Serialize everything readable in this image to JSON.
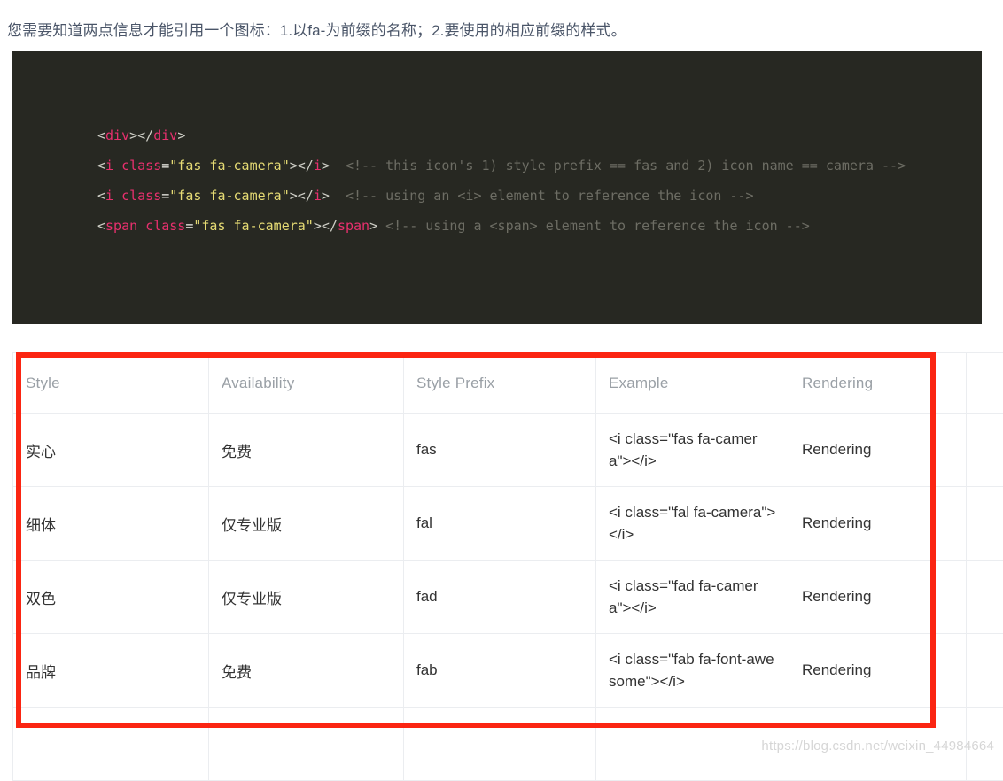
{
  "page": {
    "intro": "您需要知道两点信息才能引用一个图标：1.以fa-为前缀的名称；2.要使用的相应前缀的样式。",
    "watermark": "https://blog.csdn.net/weixin_44984664"
  },
  "code_block": {
    "background_color": "#272822",
    "lines": [
      {
        "id": "line-1",
        "tokens": [
          {
            "type": "punct",
            "text": "<"
          },
          {
            "type": "tag",
            "text": "div"
          },
          {
            "type": "punct",
            "text": "></"
          },
          {
            "type": "tag",
            "text": "div"
          },
          {
            "type": "punct",
            "text": ">"
          }
        ]
      },
      {
        "id": "line-2",
        "tokens": [
          {
            "type": "punct",
            "text": "<"
          },
          {
            "type": "tag",
            "text": "i"
          },
          {
            "type": "punct",
            "text": " "
          },
          {
            "type": "attr",
            "text": "class"
          },
          {
            "type": "op",
            "text": "="
          },
          {
            "type": "string",
            "text": "\"fas fa-camera\""
          },
          {
            "type": "punct",
            "text": "></"
          },
          {
            "type": "tag",
            "text": "i"
          },
          {
            "type": "punct",
            "text": ">"
          },
          {
            "type": "comment",
            "text": "  <!-- this icon's 1) style prefix == fas and 2) icon name == camera -->"
          }
        ]
      },
      {
        "id": "line-3",
        "tokens": [
          {
            "type": "punct",
            "text": "<"
          },
          {
            "type": "tag",
            "text": "i"
          },
          {
            "type": "punct",
            "text": " "
          },
          {
            "type": "attr",
            "text": "class"
          },
          {
            "type": "op",
            "text": "="
          },
          {
            "type": "string",
            "text": "\"fas fa-camera\""
          },
          {
            "type": "punct",
            "text": "></"
          },
          {
            "type": "tag",
            "text": "i"
          },
          {
            "type": "punct",
            "text": ">"
          },
          {
            "type": "comment",
            "text": "  <!-- using an <i> element to reference the icon -->"
          }
        ]
      },
      {
        "id": "line-4",
        "tokens": [
          {
            "type": "punct",
            "text": "<"
          },
          {
            "type": "tag",
            "text": "span"
          },
          {
            "type": "punct",
            "text": " "
          },
          {
            "type": "attr",
            "text": "class"
          },
          {
            "type": "op",
            "text": "="
          },
          {
            "type": "string",
            "text": "\"fas fa-camera\""
          },
          {
            "type": "punct",
            "text": "></"
          },
          {
            "type": "tag",
            "text": "span"
          },
          {
            "type": "punct",
            "text": ">"
          },
          {
            "type": "comment",
            "text": " <!-- using a <span> element to reference the icon -->"
          }
        ]
      }
    ]
  },
  "table": {
    "headers": [
      "Style",
      "Availability",
      "Style Prefix",
      "Example",
      "Rendering",
      ""
    ],
    "rows": [
      {
        "style": "实心",
        "availability": "免费",
        "prefix": "fas",
        "example": "<i class=\"fas fa-camera\"></i>",
        "rendering": "Rendering",
        "extra": ""
      },
      {
        "style": "细体",
        "availability": "仅专业版",
        "prefix": "fal",
        "example": "<i class=\"fal fa-camera\"></i>",
        "rendering": "Rendering",
        "extra": ""
      },
      {
        "style": "双色",
        "availability": "仅专业版",
        "prefix": "fad",
        "example": "<i class=\"fad fa-camera\"></i>",
        "rendering": "Rendering",
        "extra": ""
      },
      {
        "style": "品牌",
        "availability": "免费",
        "prefix": "fab",
        "example": "<i class=\"fab fa-font-awesome\"></i>",
        "rendering": "Rendering",
        "extra": ""
      }
    ]
  },
  "annotation": {
    "highlight_color": "#fb2512",
    "shape": "rectangle"
  }
}
